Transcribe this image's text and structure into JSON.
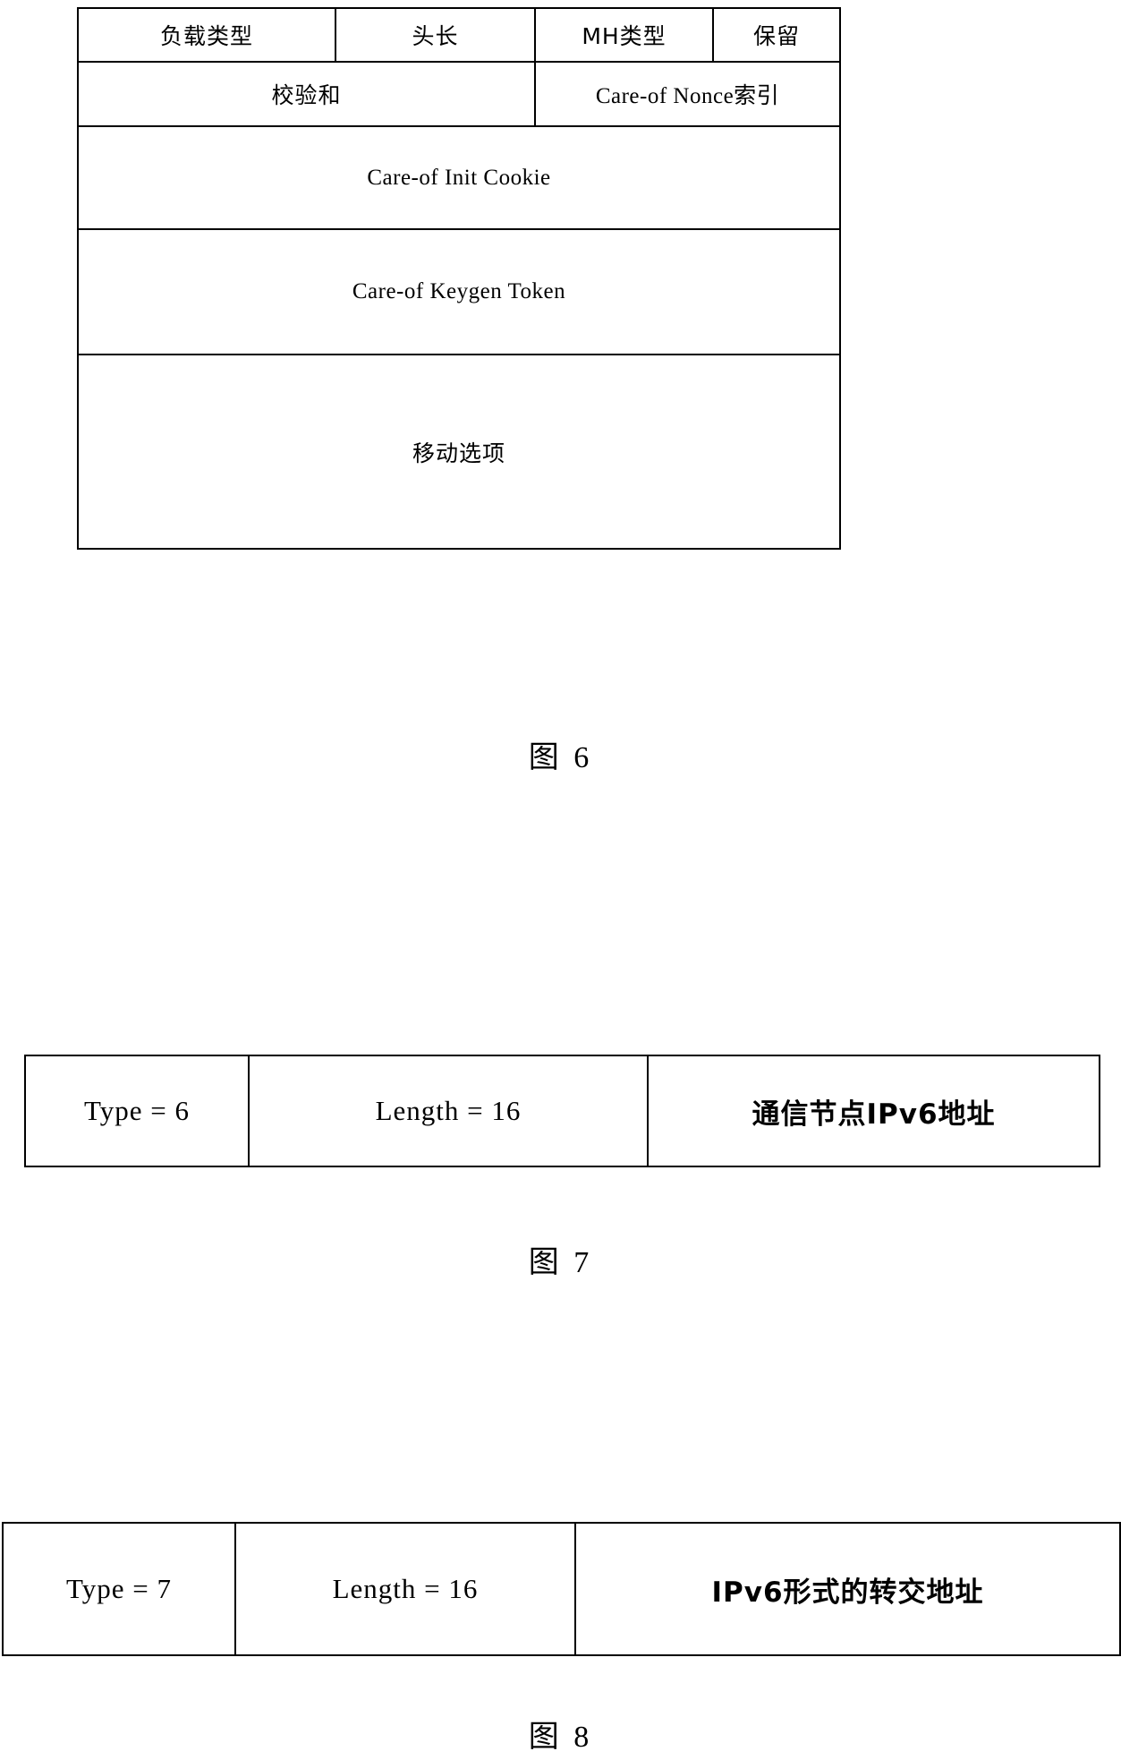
{
  "document": {
    "type": "patent-drawing-sheet",
    "background_color": "#ffffff",
    "line_color": "#000000"
  },
  "figures": [
    {
      "id": "figure-6",
      "caption": "图 6",
      "title_description": "Care-of Test message format",
      "rows": [
        {
          "id": "fig6-row-1",
          "cells": [
            {
              "label": "负载类型",
              "script": "cn"
            },
            {
              "label": "头长",
              "script": "cn"
            },
            {
              "label": "MH类型",
              "script": "cn"
            },
            {
              "label": "保留",
              "script": "cn"
            }
          ]
        },
        {
          "id": "fig6-row-2",
          "cells": [
            {
              "label": "校验和",
              "script": "cn"
            },
            {
              "label": "Care-of Nonce索引",
              "script": "mixed"
            }
          ]
        },
        {
          "id": "fig6-row-3",
          "cells": [
            {
              "label": "Care-of Init Cookie",
              "script": "en"
            }
          ]
        },
        {
          "id": "fig6-row-4",
          "cells": [
            {
              "label": "Care-of Keygen Token",
              "script": "en"
            }
          ]
        },
        {
          "id": "fig6-row-5",
          "cells": [
            {
              "label": "移动选项",
              "script": "cn"
            }
          ]
        }
      ]
    },
    {
      "id": "figure-7",
      "caption": "图 7",
      "title_description": "Correspondent node IPv6 address option",
      "rows": [
        {
          "id": "fig7-row-1",
          "cells": [
            {
              "label": "Type = 6",
              "script": "en"
            },
            {
              "label": "Length = 16",
              "script": "en"
            },
            {
              "label": "通信节点IPv6地址",
              "script": "cn"
            }
          ]
        }
      ]
    },
    {
      "id": "figure-8",
      "caption": "图 8",
      "title_description": "Care-of address in IPv6 form option",
      "rows": [
        {
          "id": "fig8-row-1",
          "cells": [
            {
              "label": "Type = 7",
              "script": "en"
            },
            {
              "label": "Length = 16",
              "script": "en"
            },
            {
              "label": "IPv6形式的转交地址",
              "script": "cn"
            }
          ]
        }
      ]
    }
  ]
}
